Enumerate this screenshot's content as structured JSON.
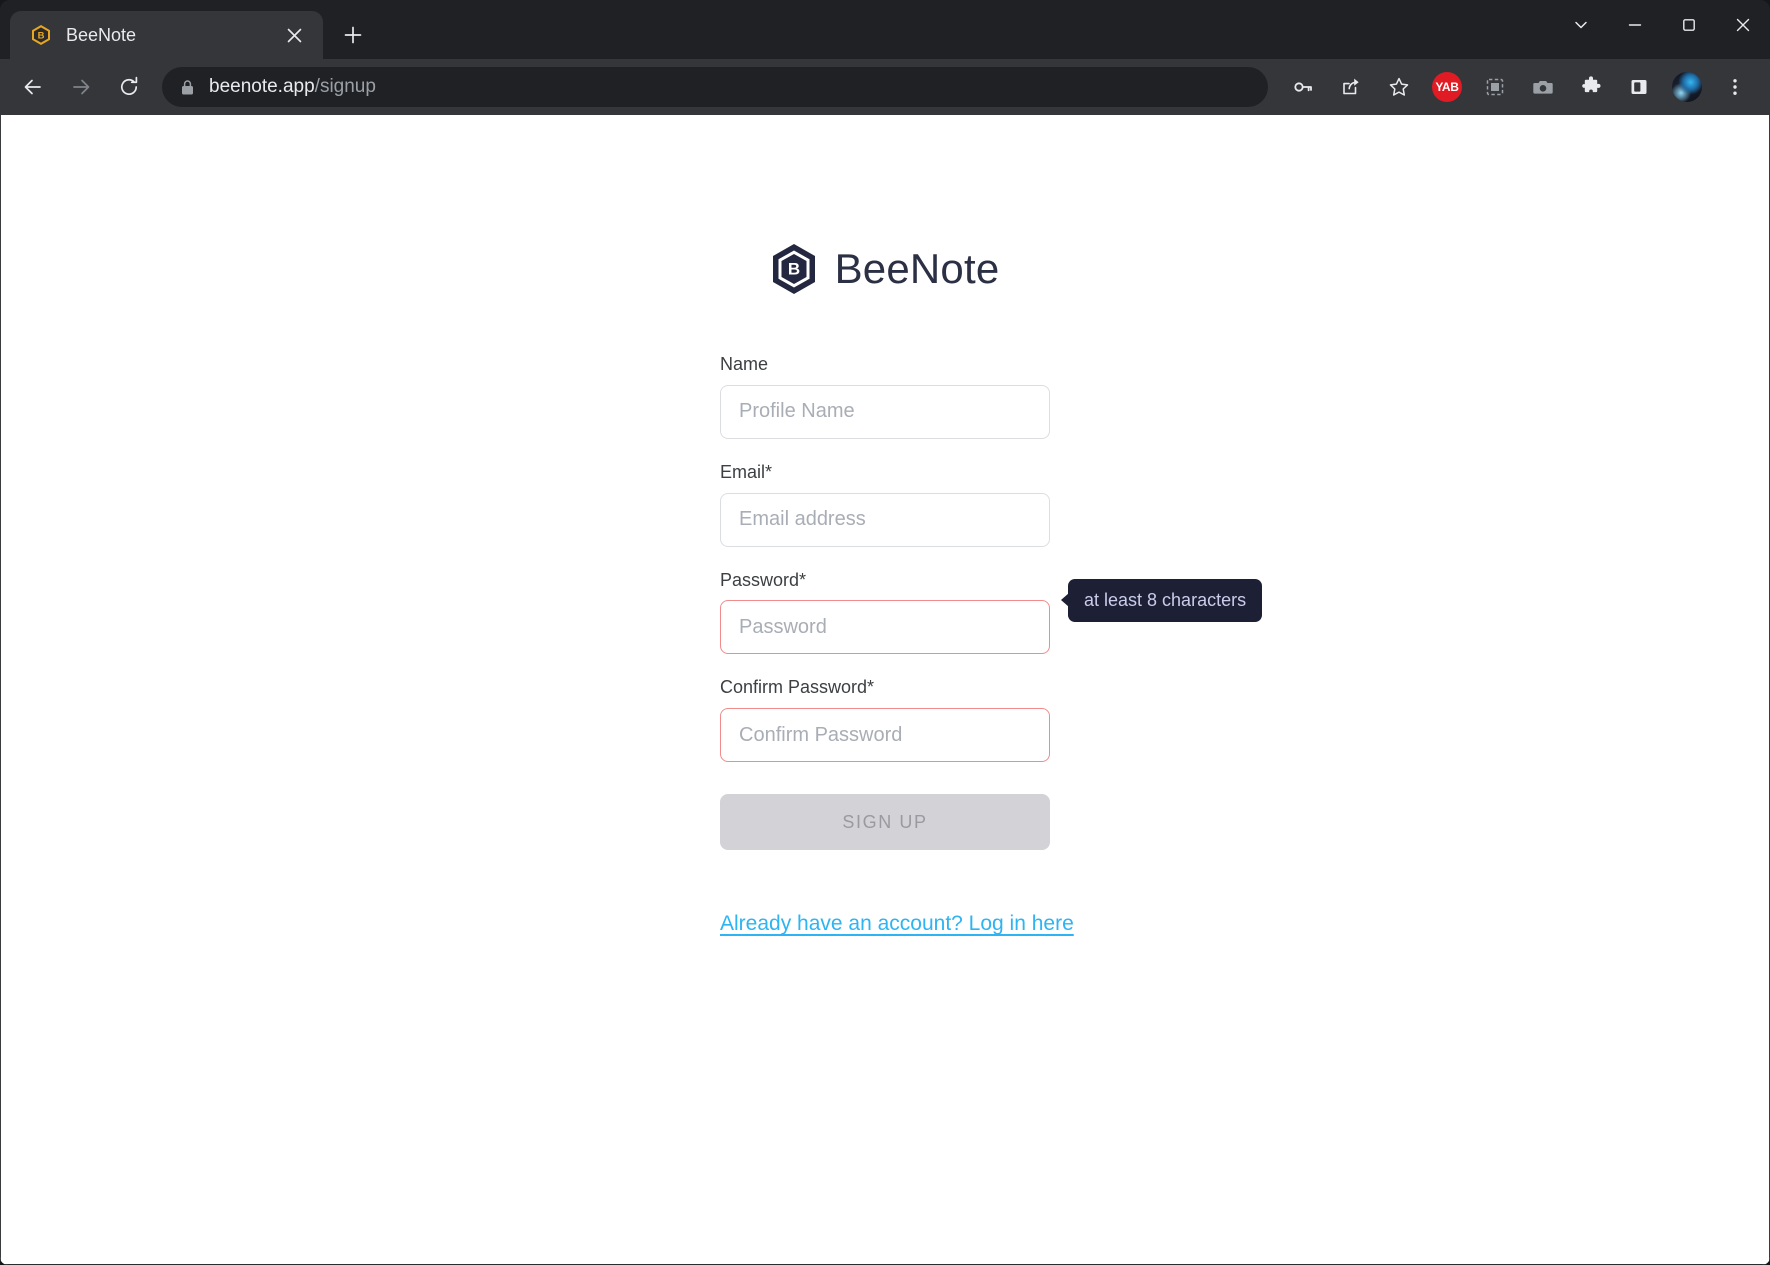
{
  "browser": {
    "tab": {
      "title": "BeeNote",
      "favicon_icon": "beenote-hexagon-favicon",
      "close_icon": "close-icon"
    },
    "new_tab_icon": "plus-icon",
    "window_controls": {
      "tab_search_icon": "chevron-down-icon",
      "minimize_icon": "minimize-icon",
      "maximize_icon": "maximize-icon",
      "close_icon": "close-icon"
    },
    "nav": {
      "back_icon": "arrow-left-icon",
      "forward_icon": "arrow-right-icon",
      "reload_icon": "reload-icon"
    },
    "omnibox": {
      "lock_icon": "lock-icon",
      "host": "beenote.app",
      "path": "/signup"
    },
    "toolbar_icons": [
      {
        "name": "password-key-icon",
        "label": ""
      },
      {
        "name": "share-icon",
        "label": ""
      },
      {
        "name": "bookmark-star-icon",
        "label": ""
      },
      {
        "name": "yab-extension-icon",
        "label": "YAB"
      },
      {
        "name": "screen-capture-icon",
        "label": ""
      },
      {
        "name": "camera-icon",
        "label": ""
      },
      {
        "name": "extensions-puzzle-icon",
        "label": ""
      },
      {
        "name": "side-panel-icon",
        "label": ""
      },
      {
        "name": "profile-avatar-icon",
        "label": ""
      },
      {
        "name": "chrome-menu-icon",
        "label": ""
      }
    ]
  },
  "page": {
    "brand": {
      "name": "BeeNote",
      "logo_icon": "beenote-hexagon-logo"
    },
    "form": {
      "fields": [
        {
          "label": "Name",
          "placeholder": "Profile Name",
          "value": "",
          "invalid": false
        },
        {
          "label": "Email*",
          "placeholder": "Email address",
          "value": "",
          "invalid": true
        },
        {
          "label": "Password*",
          "placeholder": "Password",
          "value": "",
          "invalid": true,
          "tooltip": "at least 8 characters"
        },
        {
          "label": "Confirm Password*",
          "placeholder": "Confirm Password",
          "value": "",
          "invalid": true
        }
      ],
      "submit_label": "SIGN UP",
      "login_link": "Already have an account? Log in here"
    }
  },
  "colors": {
    "accent_link": "#2eb4f2",
    "brand_dark": "#2b3044",
    "favicon_gold": "#e8a723",
    "error_border": "#f08c8c",
    "tooltip_bg": "#1d2035",
    "tooltip_text": "#c9ccea",
    "disabled_button_bg": "#d2d2d7",
    "extension_badge": "#e01b24"
  }
}
